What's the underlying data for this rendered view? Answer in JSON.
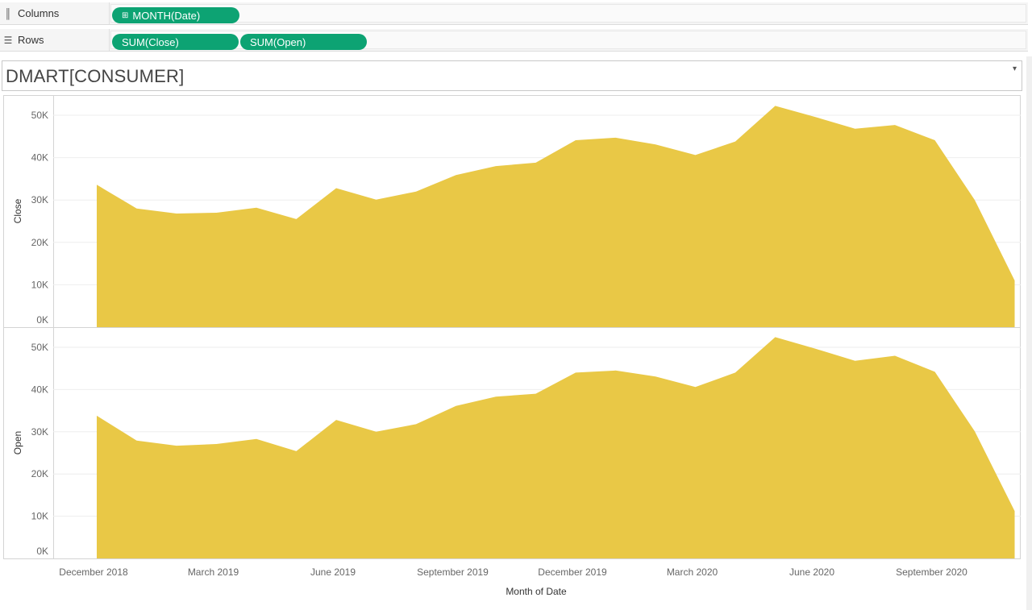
{
  "shelves": {
    "columns": {
      "label": "Columns",
      "icon": "columns-icon",
      "pills": [
        {
          "text": "MONTH(Date)",
          "icon": "plus-box-icon"
        }
      ]
    },
    "rows": {
      "label": "Rows",
      "icon": "rows-icon",
      "pills": [
        {
          "text": "SUM(Close)"
        },
        {
          "text": "SUM(Open)"
        }
      ]
    }
  },
  "worksheet": {
    "title": "DMART[CONSUMER]"
  },
  "colors": {
    "area_fill": "#e9c846",
    "pill_bg": "#0da373",
    "grid": "#eeeeee"
  },
  "chart_data": [
    {
      "type": "area",
      "ylabel": "Close",
      "ylim": [
        0,
        55000
      ],
      "yticks": [
        "0K",
        "10K",
        "20K",
        "30K",
        "40K",
        "50K"
      ],
      "x": [
        "2018-12",
        "2019-01",
        "2019-02",
        "2019-03",
        "2019-04",
        "2019-05",
        "2019-06",
        "2019-07",
        "2019-08",
        "2019-09",
        "2019-10",
        "2019-11",
        "2019-12",
        "2020-01",
        "2020-02",
        "2020-03",
        "2020-04",
        "2020-05",
        "2020-06",
        "2020-07",
        "2020-08",
        "2020-09",
        "2020-10",
        "2020-11"
      ],
      "values": [
        33600,
        28000,
        26800,
        27000,
        28200,
        25500,
        32800,
        30100,
        32000,
        35900,
        38000,
        38800,
        44100,
        44700,
        43100,
        40600,
        43800,
        52200,
        49600,
        46800,
        47700,
        44100,
        30000,
        11000
      ]
    },
    {
      "type": "area",
      "ylabel": "Open",
      "ylim": [
        0,
        55000
      ],
      "yticks": [
        "0K",
        "10K",
        "20K",
        "30K",
        "40K",
        "50K"
      ],
      "x": [
        "2018-12",
        "2019-01",
        "2019-02",
        "2019-03",
        "2019-04",
        "2019-05",
        "2019-06",
        "2019-07",
        "2019-08",
        "2019-09",
        "2019-10",
        "2019-11",
        "2019-12",
        "2020-01",
        "2020-02",
        "2020-03",
        "2020-04",
        "2020-05",
        "2020-06",
        "2020-07",
        "2020-08",
        "2020-09",
        "2020-10",
        "2020-11"
      ],
      "values": [
        33800,
        27900,
        26700,
        27100,
        28300,
        25400,
        32800,
        30000,
        31800,
        36100,
        38300,
        39000,
        44000,
        44500,
        43100,
        40600,
        44000,
        52400,
        49700,
        46800,
        48000,
        44200,
        30100,
        11200
      ]
    }
  ],
  "x_axis": {
    "title": "Month of Date",
    "tick_labels": [
      "December 2018",
      "March 2019",
      "June 2019",
      "September 2019",
      "December 2019",
      "March 2020",
      "June 2020",
      "September 2020"
    ],
    "tick_months": [
      "2018-12",
      "2019-03",
      "2019-06",
      "2019-09",
      "2019-12",
      "2020-03",
      "2020-06",
      "2020-09"
    ]
  }
}
